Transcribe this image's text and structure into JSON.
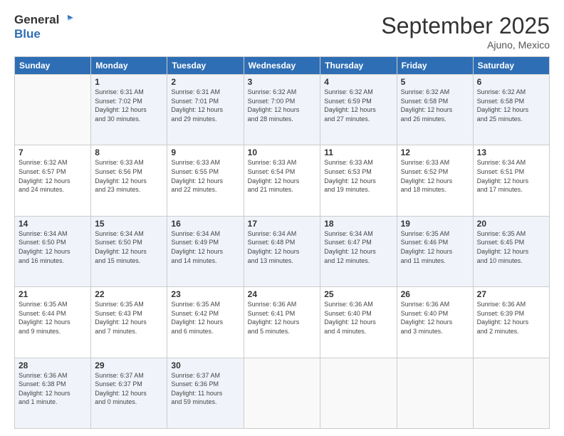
{
  "logo": {
    "line1": "General",
    "line2": "Blue"
  },
  "header": {
    "month": "September 2025",
    "location": "Ajuno, Mexico"
  },
  "weekdays": [
    "Sunday",
    "Monday",
    "Tuesday",
    "Wednesday",
    "Thursday",
    "Friday",
    "Saturday"
  ],
  "weeks": [
    [
      {
        "day": "",
        "info": ""
      },
      {
        "day": "1",
        "info": "Sunrise: 6:31 AM\nSunset: 7:02 PM\nDaylight: 12 hours\nand 30 minutes."
      },
      {
        "day": "2",
        "info": "Sunrise: 6:31 AM\nSunset: 7:01 PM\nDaylight: 12 hours\nand 29 minutes."
      },
      {
        "day": "3",
        "info": "Sunrise: 6:32 AM\nSunset: 7:00 PM\nDaylight: 12 hours\nand 28 minutes."
      },
      {
        "day": "4",
        "info": "Sunrise: 6:32 AM\nSunset: 6:59 PM\nDaylight: 12 hours\nand 27 minutes."
      },
      {
        "day": "5",
        "info": "Sunrise: 6:32 AM\nSunset: 6:58 PM\nDaylight: 12 hours\nand 26 minutes."
      },
      {
        "day": "6",
        "info": "Sunrise: 6:32 AM\nSunset: 6:58 PM\nDaylight: 12 hours\nand 25 minutes."
      }
    ],
    [
      {
        "day": "7",
        "info": "Sunrise: 6:32 AM\nSunset: 6:57 PM\nDaylight: 12 hours\nand 24 minutes."
      },
      {
        "day": "8",
        "info": "Sunrise: 6:33 AM\nSunset: 6:56 PM\nDaylight: 12 hours\nand 23 minutes."
      },
      {
        "day": "9",
        "info": "Sunrise: 6:33 AM\nSunset: 6:55 PM\nDaylight: 12 hours\nand 22 minutes."
      },
      {
        "day": "10",
        "info": "Sunrise: 6:33 AM\nSunset: 6:54 PM\nDaylight: 12 hours\nand 21 minutes."
      },
      {
        "day": "11",
        "info": "Sunrise: 6:33 AM\nSunset: 6:53 PM\nDaylight: 12 hours\nand 19 minutes."
      },
      {
        "day": "12",
        "info": "Sunrise: 6:33 AM\nSunset: 6:52 PM\nDaylight: 12 hours\nand 18 minutes."
      },
      {
        "day": "13",
        "info": "Sunrise: 6:34 AM\nSunset: 6:51 PM\nDaylight: 12 hours\nand 17 minutes."
      }
    ],
    [
      {
        "day": "14",
        "info": "Sunrise: 6:34 AM\nSunset: 6:50 PM\nDaylight: 12 hours\nand 16 minutes."
      },
      {
        "day": "15",
        "info": "Sunrise: 6:34 AM\nSunset: 6:50 PM\nDaylight: 12 hours\nand 15 minutes."
      },
      {
        "day": "16",
        "info": "Sunrise: 6:34 AM\nSunset: 6:49 PM\nDaylight: 12 hours\nand 14 minutes."
      },
      {
        "day": "17",
        "info": "Sunrise: 6:34 AM\nSunset: 6:48 PM\nDaylight: 12 hours\nand 13 minutes."
      },
      {
        "day": "18",
        "info": "Sunrise: 6:34 AM\nSunset: 6:47 PM\nDaylight: 12 hours\nand 12 minutes."
      },
      {
        "day": "19",
        "info": "Sunrise: 6:35 AM\nSunset: 6:46 PM\nDaylight: 12 hours\nand 11 minutes."
      },
      {
        "day": "20",
        "info": "Sunrise: 6:35 AM\nSunset: 6:45 PM\nDaylight: 12 hours\nand 10 minutes."
      }
    ],
    [
      {
        "day": "21",
        "info": "Sunrise: 6:35 AM\nSunset: 6:44 PM\nDaylight: 12 hours\nand 9 minutes."
      },
      {
        "day": "22",
        "info": "Sunrise: 6:35 AM\nSunset: 6:43 PM\nDaylight: 12 hours\nand 7 minutes."
      },
      {
        "day": "23",
        "info": "Sunrise: 6:35 AM\nSunset: 6:42 PM\nDaylight: 12 hours\nand 6 minutes."
      },
      {
        "day": "24",
        "info": "Sunrise: 6:36 AM\nSunset: 6:41 PM\nDaylight: 12 hours\nand 5 minutes."
      },
      {
        "day": "25",
        "info": "Sunrise: 6:36 AM\nSunset: 6:40 PM\nDaylight: 12 hours\nand 4 minutes."
      },
      {
        "day": "26",
        "info": "Sunrise: 6:36 AM\nSunset: 6:40 PM\nDaylight: 12 hours\nand 3 minutes."
      },
      {
        "day": "27",
        "info": "Sunrise: 6:36 AM\nSunset: 6:39 PM\nDaylight: 12 hours\nand 2 minutes."
      }
    ],
    [
      {
        "day": "28",
        "info": "Sunrise: 6:36 AM\nSunset: 6:38 PM\nDaylight: 12 hours\nand 1 minute."
      },
      {
        "day": "29",
        "info": "Sunrise: 6:37 AM\nSunset: 6:37 PM\nDaylight: 12 hours\nand 0 minutes."
      },
      {
        "day": "30",
        "info": "Sunrise: 6:37 AM\nSunset: 6:36 PM\nDaylight: 11 hours\nand 59 minutes."
      },
      {
        "day": "",
        "info": ""
      },
      {
        "day": "",
        "info": ""
      },
      {
        "day": "",
        "info": ""
      },
      {
        "day": "",
        "info": ""
      }
    ]
  ]
}
